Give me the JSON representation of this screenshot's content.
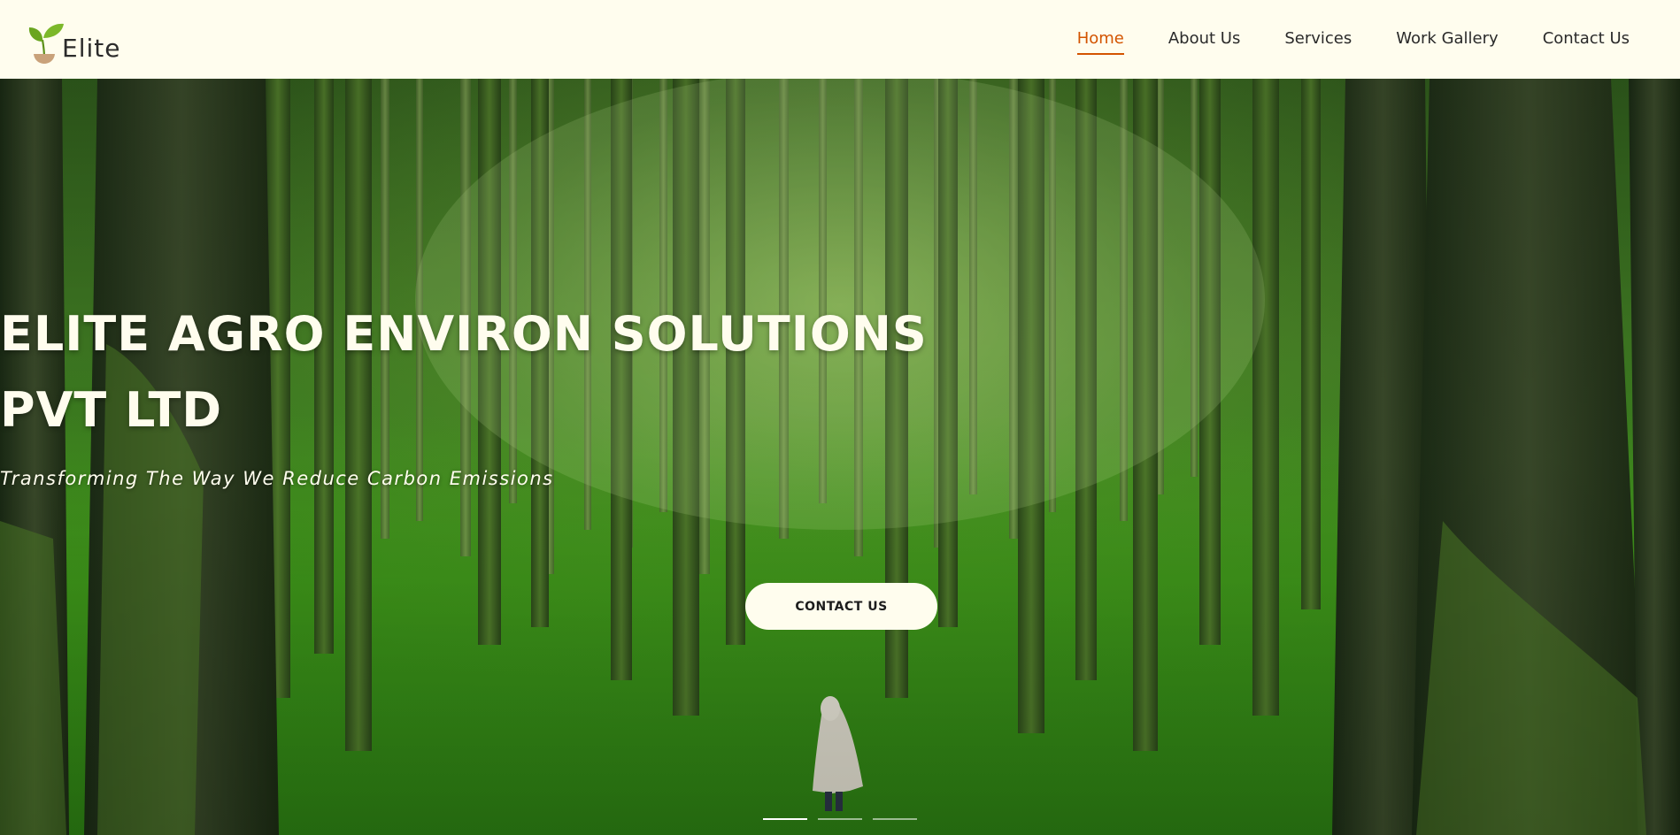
{
  "brand": {
    "name": "Elite",
    "logo_icon": "sprout-in-pot-icon",
    "leaf_color": "#6aa51f",
    "pot_color": "#c9a27a"
  },
  "nav": {
    "items": [
      {
        "label": "Home",
        "active": true
      },
      {
        "label": "About Us",
        "active": false
      },
      {
        "label": "Services",
        "active": false
      },
      {
        "label": "Work Gallery",
        "active": false
      },
      {
        "label": "Contact Us",
        "active": false
      }
    ],
    "active_color": "#d35400"
  },
  "hero": {
    "title_line1": "ELITE AGRO ENVIRON SOLUTIONS",
    "title_line2": "PVT LTD",
    "subtitle": "Transforming The Way We Reduce Carbon Emissions",
    "cta_label": "CONTACT US",
    "background": "forest with tall moss-covered trees and a hooded figure",
    "slides": [
      {
        "active": true
      },
      {
        "active": false
      },
      {
        "active": false
      }
    ]
  },
  "colors": {
    "header_bg": "#fffdee",
    "text_light": "#fffdee",
    "text_dark": "#2a2a2a"
  }
}
